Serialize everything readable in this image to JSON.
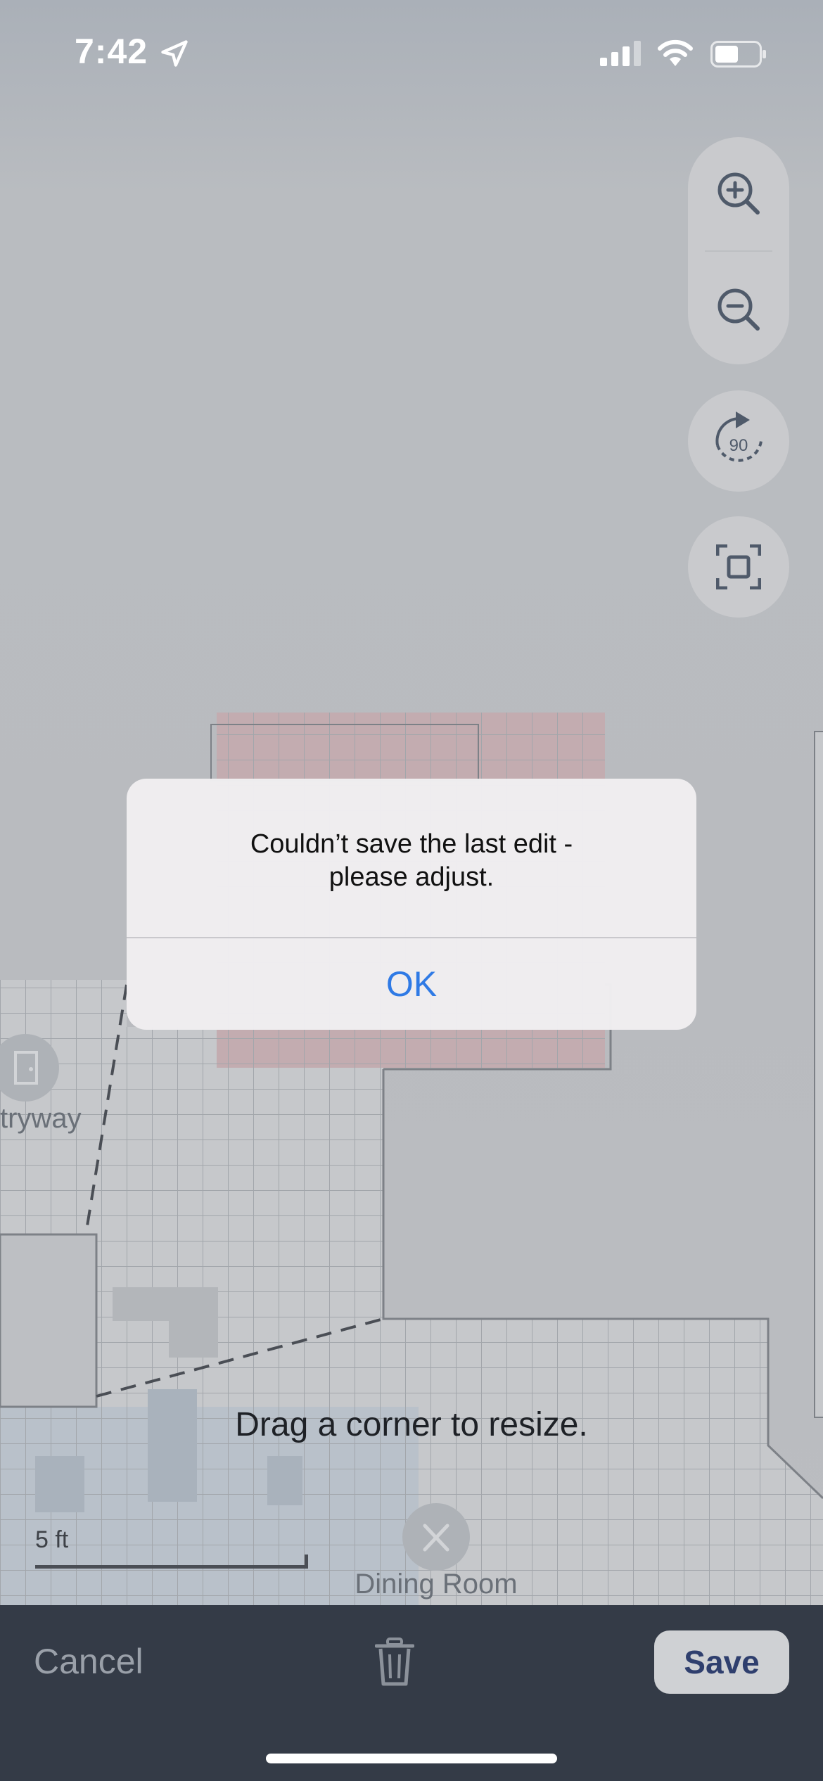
{
  "status_bar": {
    "time": "7:42"
  },
  "map": {
    "scale_label": "5 ft",
    "rooms": {
      "entryway": "tryway",
      "dining": "Dining Room"
    },
    "hint": "Drag a corner to resize."
  },
  "controls": {
    "zoom_in_icon": "zoom-in-icon",
    "zoom_out_icon": "zoom-out-icon",
    "rotate_label": "90",
    "fit_icon": "fit-screen-icon"
  },
  "alert": {
    "message_line1": "Couldn’t save the last edit -",
    "message_line2": "please adjust.",
    "ok_label": "OK"
  },
  "bottom_bar": {
    "cancel_label": "Cancel",
    "save_label": "Save"
  },
  "colors": {
    "accent": "#2f7ae5",
    "toolbar": "#343b47",
    "save_text": "#2f3f6e"
  }
}
